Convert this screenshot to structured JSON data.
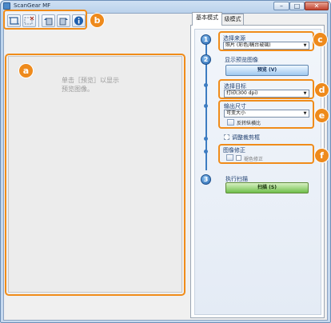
{
  "window": {
    "title": "ScanGear MF"
  },
  "toolbar": {
    "buttons": [
      {
        "icon": "crop-icon"
      },
      {
        "icon": "clear-icon"
      },
      {
        "icon": "rotate-left-icon"
      },
      {
        "icon": "rotate-right-icon"
      },
      {
        "icon": "info-icon"
      }
    ]
  },
  "callouts": {
    "a": "a",
    "b": "b",
    "c": "c",
    "d": "d",
    "e": "e",
    "f": "f"
  },
  "preview": {
    "message": "单击［预览］以显示\n预览图像。"
  },
  "tabs": {
    "basic": "基本模式",
    "advanced": "级模式"
  },
  "steps": {
    "one": "1",
    "two": "2",
    "three": "3"
  },
  "select_source": {
    "label": "选择来源",
    "value": "照片 (彩色/稿台玻璃)"
  },
  "preview_section": {
    "label": "显示预览图像",
    "button": "预览 (V)"
  },
  "destination": {
    "label": "选择目标",
    "value": "打印(300 dpi)"
  },
  "output_size": {
    "label": "输出尺寸",
    "value": "可变大小",
    "option_label": "反转纵横比"
  },
  "adjust_crop": {
    "label": "调整裁剪框"
  },
  "image_correction": {
    "label": "图像修正",
    "option_label": "褪色修正"
  },
  "scan_section": {
    "label": "执行扫描",
    "button": "扫描 (S)"
  },
  "colors": {
    "accent_orange": "#ee8a1c",
    "step_blue": "#3d7cc1",
    "scan_green": "#6fbf4b"
  }
}
